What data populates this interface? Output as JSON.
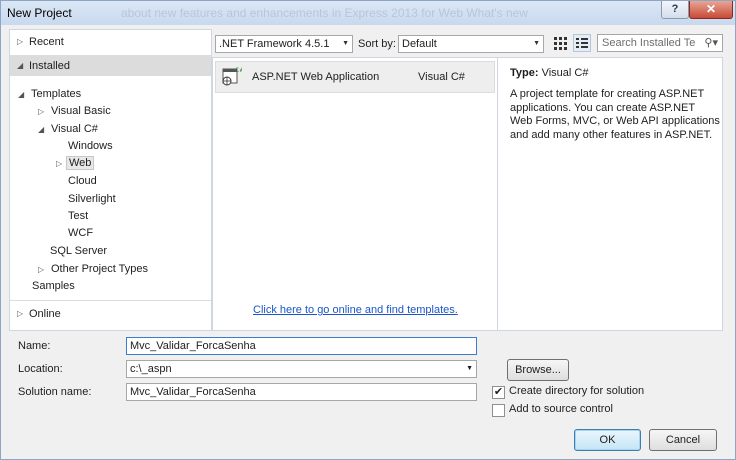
{
  "window": {
    "title": "New Project",
    "background_title": "about new features and enhancements in Express 2013 for Web          What's new"
  },
  "title_buttons": {
    "help": "?",
    "close": "✕"
  },
  "left_panel": {
    "recent": "Recent",
    "installed": "Installed",
    "tree": {
      "templates": "Templates",
      "visual_basic": "Visual Basic",
      "visual_csharp": "Visual C#",
      "windows": "Windows",
      "web": "Web",
      "cloud": "Cloud",
      "silverlight": "Silverlight",
      "test": "Test",
      "wcf": "WCF",
      "sql_server": "SQL Server",
      "other_project_types": "Other Project Types",
      "samples": "Samples"
    },
    "online": "Online"
  },
  "toolbar": {
    "framework": ".NET Framework 4.5.1",
    "sort_label": "Sort by:",
    "sort_value": "Default",
    "search_placeholder": "Search Installed Te"
  },
  "templates": [
    {
      "name": "ASP.NET Web Application",
      "language": "Visual C#"
    }
  ],
  "online_link": "Click here to go online and find templates.",
  "details": {
    "type_label": "Type:",
    "type_value": "Visual C#",
    "description": "A project template for creating ASP.NET applications. You can create ASP.NET Web Forms, MVC,  or Web API applications and add many other features in ASP.NET."
  },
  "form": {
    "name_label": "Name:",
    "name_value": "Mvc_Validar_ForcaSenha",
    "location_label": "Location:",
    "location_value": "c:\\_aspn",
    "solution_label": "Solution name:",
    "solution_value": "Mvc_Validar_ForcaSenha",
    "browse": "Browse...",
    "create_dir": "Create directory for solution",
    "create_dir_checked": true,
    "add_source": "Add to source control",
    "add_source_checked": false,
    "ok": "OK",
    "cancel": "Cancel"
  },
  "colors": {
    "accent": "#3c7fb1",
    "link": "#1a55c9",
    "selected": "#dcdcdc"
  },
  "icons": [
    "chevron-right-icon",
    "chevron-down-icon",
    "small-icons-view-icon",
    "list-view-icon",
    "search-icon",
    "web-project-icon"
  ]
}
